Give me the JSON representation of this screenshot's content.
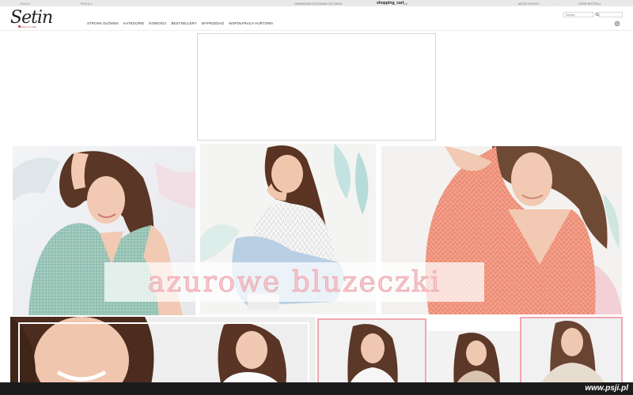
{
  "topbar": {
    "left_1": "Pol 0 z",
    "left_2": "PLN 0 z",
    "shipping_note": "DARMOWA DOSTAWA OD 250ZŁ",
    "cart_label": "shopping_cart",
    "cart_count": "(0)",
    "account_label": "MOJE KONTO",
    "separator": "/",
    "register_label": "ZAREJESTRUJ"
  },
  "header": {
    "logo_text": "Setin",
    "logo_sub": "fashion & moda",
    "search_placeholder": "Szukaj...",
    "nav": [
      "STRONA GŁÓWNA",
      "KATEGORIE",
      "NOWOŚCI",
      "BESTSELLERY",
      "WYPRZEDAŻ",
      "WSPÓŁPRACA HURTOWA"
    ]
  },
  "hero": {
    "slogan": "azurowe bluzeczki"
  },
  "watermark": "www.psji.pl",
  "colors": {
    "accent_pink": "#f0a7b0",
    "mint": "#9ec9bb",
    "coral": "#f19a84",
    "topbar_bg": "#e9e9e9"
  },
  "icons": [
    "search-icon",
    "instagram-icon"
  ]
}
